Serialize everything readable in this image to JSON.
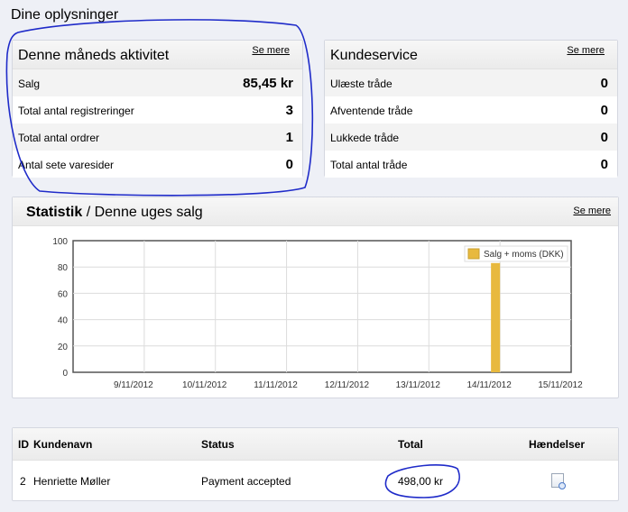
{
  "page": {
    "title": "Dine oplysninger"
  },
  "activity": {
    "title": "Denne måneds aktivitet",
    "see_more": "Se mere",
    "rows": [
      {
        "label": "Salg",
        "value": "85,45 kr"
      },
      {
        "label": "Total antal registreringer",
        "value": "3"
      },
      {
        "label": "Total antal ordrer",
        "value": "1"
      },
      {
        "label": "Antal sete varesider",
        "value": "0"
      }
    ]
  },
  "customer_service": {
    "title": "Kundeservice",
    "see_more": "Se mere",
    "rows": [
      {
        "label": "Ulæste tråde",
        "value": "0"
      },
      {
        "label": "Afventende tråde",
        "value": "0"
      },
      {
        "label": "Lukkede tråde",
        "value": "0"
      },
      {
        "label": "Total antal tråde",
        "value": "0"
      }
    ]
  },
  "statistics": {
    "title_bold": "Statistik",
    "title_rest": " / Denne uges salg",
    "see_more": "Se mere"
  },
  "chart_data": {
    "type": "bar",
    "categories": [
      "9/11/2012",
      "10/11/2012",
      "11/11/2012",
      "12/11/2012",
      "13/11/2012",
      "14/11/2012",
      "15/11/2012"
    ],
    "series": [
      {
        "name": "Salg + moms (DKK)",
        "values": [
          0,
          0,
          0,
          0,
          0,
          83,
          0
        ],
        "color": "#e8b93e"
      }
    ],
    "yticks": [
      0,
      20,
      40,
      60,
      80,
      100
    ],
    "ylim": [
      0,
      100
    ],
    "grid": true,
    "legend": "top-right"
  },
  "orders": {
    "headers": {
      "id": "ID",
      "name": "Kundenavn",
      "status": "Status",
      "total": "Total",
      "actions": "Hændelser"
    },
    "rows": [
      {
        "id": "2",
        "name": "Henriette Møller",
        "status": "Payment accepted",
        "total": "498,00 kr",
        "action_icon": "view-icon"
      }
    ]
  },
  "colors": {
    "annotation": "#1f2bc9",
    "bar": "#e8b93e"
  }
}
